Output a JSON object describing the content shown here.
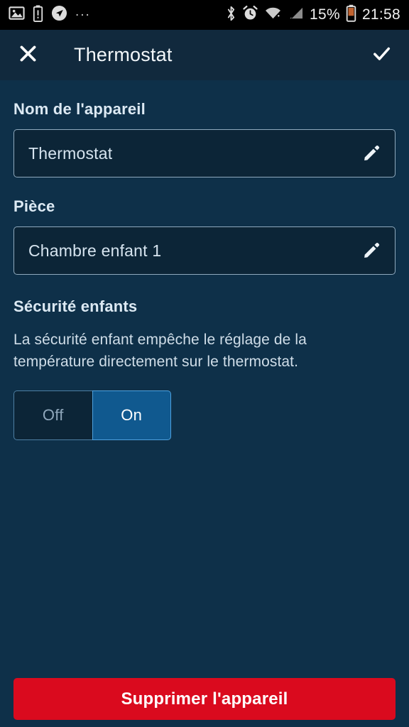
{
  "status_bar": {
    "left_icons": [
      "image-icon",
      "battery-alert-icon",
      "location-arrow-icon",
      "overflow-dots-icon"
    ],
    "overflow": "...",
    "right_icons": [
      "bluetooth-icon",
      "alarm-clock-icon",
      "wifi-icon",
      "cell-signal-icon",
      "battery-icon"
    ],
    "battery_percent": "15%",
    "time": "21:58"
  },
  "app_bar": {
    "close_icon": "close-icon",
    "title": "Thermostat",
    "confirm_icon": "check-icon"
  },
  "form": {
    "device_name": {
      "label": "Nom de l'appareil",
      "value": "Thermostat",
      "edit_icon": "pencil-icon"
    },
    "room": {
      "label": "Pièce",
      "value": "Chambre enfant 1",
      "edit_icon": "pencil-icon"
    }
  },
  "child_lock": {
    "title": "Sécurité enfants",
    "description": "La sécurité enfant empêche le réglage de la température directement sur le thermostat.",
    "options": [
      {
        "label": "Off",
        "selected": false
      },
      {
        "label": "On",
        "selected": true
      }
    ],
    "selected": "On"
  },
  "actions": {
    "delete_label": "Supprimer l'appareil"
  },
  "colors": {
    "background": "#0e3049",
    "app_bar": "#11293d",
    "field_background": "#0c2537",
    "accent_blue": "#10598f",
    "danger_red": "#da0a1e",
    "text_primary": "#dce9f3"
  }
}
